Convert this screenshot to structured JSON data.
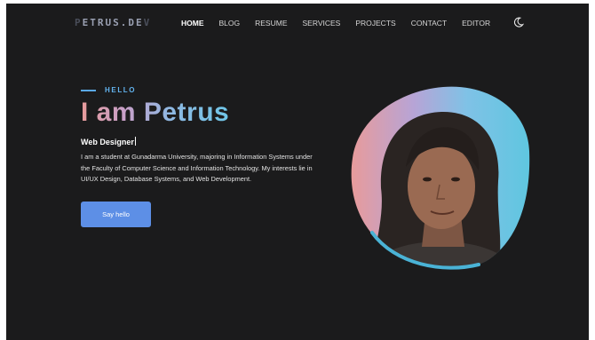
{
  "header": {
    "logo_text_bright": "ETRUS.DE",
    "logo_text_dim_start": "P",
    "logo_text_dim_end": "V",
    "nav": [
      {
        "label": "HOME",
        "active": true
      },
      {
        "label": "BLOG",
        "active": false
      },
      {
        "label": "RESUME",
        "active": false
      },
      {
        "label": "SERVICES",
        "active": false
      },
      {
        "label": "PROJECTS",
        "active": false
      },
      {
        "label": "CONTACT",
        "active": false
      },
      {
        "label": "EDITOR",
        "active": false
      }
    ],
    "theme_toggle_icon": "moon-icon"
  },
  "hero": {
    "eyebrow": "HELLO",
    "headline": "I am Petrus",
    "role": "Web Designer",
    "bio": "I am a student at Gunadarma University, majoring in Information Systems under the Faculty of Computer Science and Information Technology. My interests lie in UI/UX Design, Database Systems, and Web Development.",
    "cta_label": "Say hello",
    "image_name": "profile-photo"
  },
  "colors": {
    "background": "#1b1b1c",
    "accent": "#5d8fe6",
    "eyebrow": "#62b3ee",
    "gradient_start": "#e89b9b",
    "gradient_end": "#6fc6e8"
  }
}
